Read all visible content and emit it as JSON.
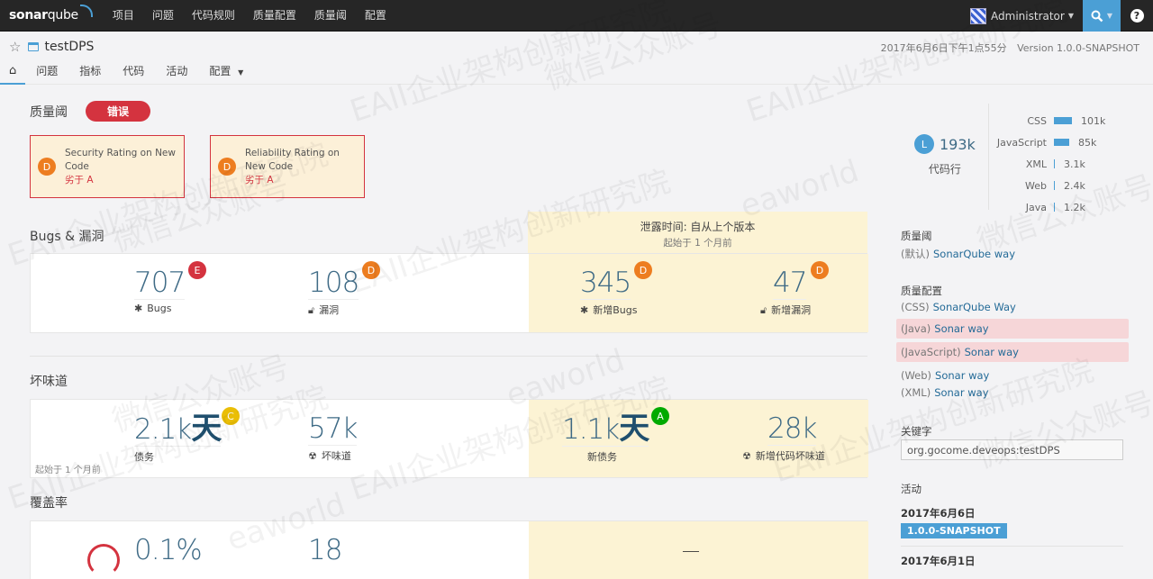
{
  "topnav": {
    "logo_bold": "sonar",
    "logo_light": "qube",
    "links": [
      "项目",
      "问题",
      "代码规则",
      "质量配置",
      "质量阈",
      "配置"
    ],
    "user": "Administrator",
    "search_icon": "search-icon",
    "help_icon": "help-icon",
    "help_glyph": "?"
  },
  "project": {
    "name": "testDPS",
    "analysis_date": "2017年6月6日下午1点55分",
    "version": "Version 1.0.0-SNAPSHOT",
    "tabs": [
      "问题",
      "指标",
      "代码",
      "活动",
      "配置"
    ]
  },
  "quality_gate": {
    "title": "质量阈",
    "status": "错误",
    "conditions": [
      {
        "rating": "D",
        "metric": "Security Rating on New Code",
        "condition": "劣于 A"
      },
      {
        "rating": "D",
        "metric": "Reliability Rating on New Code",
        "condition": "劣于 A"
      }
    ]
  },
  "leak_period": {
    "title": "泄露时间: 自从上个版本",
    "subtitle": "起始于 1 个月前"
  },
  "bugs_section": {
    "title": "Bugs & 漏洞",
    "bugs": {
      "value": "707",
      "rating": "E",
      "label": "Bugs"
    },
    "vulnerabilities": {
      "value": "108",
      "rating": "D",
      "label": "漏洞"
    },
    "new_bugs": {
      "value": "345",
      "rating": "D",
      "label": "新增Bugs"
    },
    "new_vulnerabilities": {
      "value": "47",
      "rating": "D",
      "label": "新增漏洞"
    }
  },
  "smells_section": {
    "title": "坏味道",
    "debt": {
      "value": "2.1k",
      "unit": "天",
      "rating": "C",
      "label": "债务"
    },
    "smells": {
      "value": "57k",
      "label": "坏味道"
    },
    "new_debt": {
      "value": "1.1k",
      "unit": "天",
      "rating": "A",
      "label": "新债务"
    },
    "new_smells": {
      "value": "28k",
      "label": "新增代码坏味道"
    },
    "since": "起始于 1 个月前"
  },
  "coverage_section": {
    "title": "覆盖率",
    "coverage": {
      "value": "0.1%"
    },
    "tests": {
      "value": "18"
    },
    "new_coverage": {
      "value": "—"
    }
  },
  "sidebar": {
    "loc": {
      "badge": "L",
      "value": "193k",
      "label": "代码行"
    },
    "languages": [
      {
        "name": "CSS",
        "value": "101k",
        "share": 0.52
      },
      {
        "name": "JavaScript",
        "value": "85k",
        "share": 0.44
      },
      {
        "name": "XML",
        "value": "3.1k",
        "share": 0.016
      },
      {
        "name": "Web",
        "value": "2.4k",
        "share": 0.012
      },
      {
        "name": "Java",
        "value": "1.2k",
        "share": 0.006
      }
    ],
    "quality_gate_title": "质量阈",
    "quality_gate": {
      "prefix": "(默认)",
      "name": "SonarQube way"
    },
    "profiles_title": "质量配置",
    "profiles": [
      {
        "lang": "(CSS)",
        "name": "SonarQube Way",
        "highlight": false
      },
      {
        "lang": "(Java)",
        "name": "Sonar way",
        "highlight": true
      },
      {
        "lang": "(JavaScript)",
        "name": "Sonar way",
        "highlight": true
      },
      {
        "lang": "(Web)",
        "name": "Sonar way",
        "highlight": false
      },
      {
        "lang": "(XML)",
        "name": "Sonar way",
        "highlight": false
      }
    ],
    "key_title": "关键字",
    "key": "org.gocome.deveops:testDPS",
    "activity_title": "活动",
    "activity": [
      {
        "date": "2017年6月6日",
        "version": "1.0.0-SNAPSHOT"
      },
      {
        "date": "2017年6月1日"
      }
    ]
  },
  "watermarks": [
    "EAII企业架构创新研究院",
    "微信公众账号",
    "eaworld"
  ]
}
